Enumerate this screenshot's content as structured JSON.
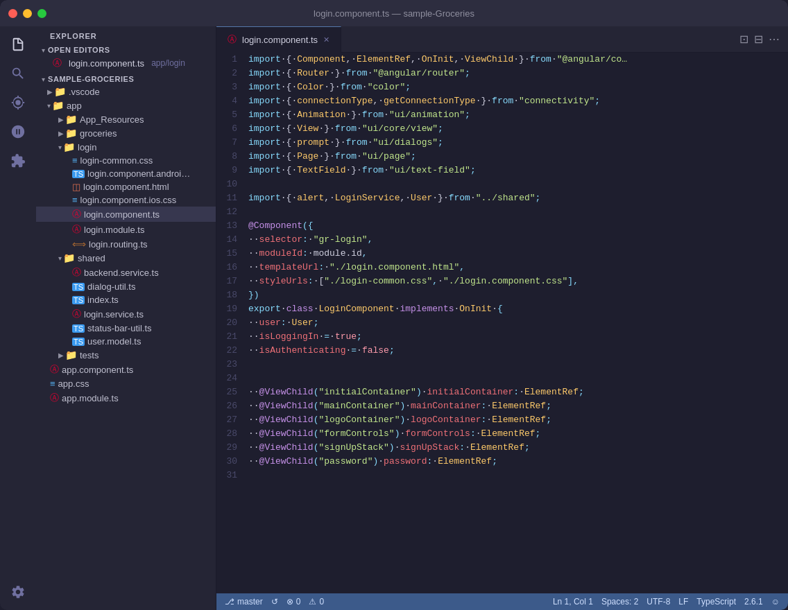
{
  "titlebar": {
    "title": "login.component.ts — sample-Groceries"
  },
  "activitybar": {
    "icons": [
      {
        "name": "files-icon",
        "symbol": "⎘",
        "active": true
      },
      {
        "name": "search-icon",
        "symbol": "🔍",
        "active": false
      },
      {
        "name": "git-icon",
        "symbol": "⑂",
        "active": false
      },
      {
        "name": "debug-icon",
        "symbol": "⊘",
        "active": false
      },
      {
        "name": "extensions-icon",
        "symbol": "⊞",
        "active": false
      }
    ],
    "bottom_icons": [
      {
        "name": "settings-icon",
        "symbol": "⚙"
      }
    ]
  },
  "sidebar": {
    "explorer_label": "EXPLORER",
    "open_editors_label": "OPEN EDITORS",
    "open_editors": [
      {
        "file": "login.component.ts",
        "path": "app/login",
        "icon": "angular"
      }
    ],
    "project_label": "SAMPLE-GROCERIES",
    "tree": [
      {
        "level": 1,
        "type": "folder",
        "label": ".vscode",
        "expanded": false
      },
      {
        "level": 1,
        "type": "folder",
        "label": "app",
        "expanded": true
      },
      {
        "level": 2,
        "type": "folder",
        "label": "App_Resources",
        "expanded": false
      },
      {
        "level": 2,
        "type": "folder",
        "label": "groceries",
        "expanded": false
      },
      {
        "level": 2,
        "type": "folder",
        "label": "login",
        "expanded": true
      },
      {
        "level": 3,
        "type": "css",
        "label": "login-common.css"
      },
      {
        "level": 3,
        "type": "ts-plain",
        "label": "login.component.androi..."
      },
      {
        "level": 3,
        "type": "html",
        "label": "login.component.html"
      },
      {
        "level": 3,
        "type": "css",
        "label": "login.component.ios.css"
      },
      {
        "level": 3,
        "type": "angular",
        "label": "login.component.ts",
        "active": true
      },
      {
        "level": 3,
        "type": "angular",
        "label": "login.module.ts"
      },
      {
        "level": 3,
        "type": "routing",
        "label": "login.routing.ts"
      },
      {
        "level": 2,
        "type": "folder",
        "label": "shared",
        "expanded": true
      },
      {
        "level": 3,
        "type": "angular",
        "label": "backend.service.ts"
      },
      {
        "level": 3,
        "type": "ts",
        "label": "dialog-util.ts"
      },
      {
        "level": 3,
        "type": "ts",
        "label": "index.ts"
      },
      {
        "level": 3,
        "type": "angular",
        "label": "login.service.ts"
      },
      {
        "level": 3,
        "type": "ts",
        "label": "status-bar-util.ts"
      },
      {
        "level": 3,
        "type": "ts",
        "label": "user.model.ts"
      },
      {
        "level": 2,
        "type": "folder",
        "label": "tests",
        "expanded": false
      },
      {
        "level": 1,
        "type": "angular",
        "label": "app.component.ts"
      },
      {
        "level": 1,
        "type": "css",
        "label": "app.css"
      },
      {
        "level": 1,
        "type": "angular",
        "label": "app.module.ts"
      }
    ]
  },
  "editor": {
    "tab_label": "login.component.ts",
    "lines": [
      {
        "n": 1,
        "code": "import·{·Component,·ElementRef,·OnInit,·ViewChild·}·from·\"@angular/co…"
      },
      {
        "n": 2,
        "code": "import·{·Router·}·from·\"@angular/router\";"
      },
      {
        "n": 3,
        "code": "import·{·Color·}·from·\"color\";"
      },
      {
        "n": 4,
        "code": "import·{·connectionType,·getConnectionType·}·from·\"connectivity\";"
      },
      {
        "n": 5,
        "code": "import·{·Animation·}·from·\"ui/animation\";"
      },
      {
        "n": 6,
        "code": "import·{·View·}·from·\"ui/core/view\";"
      },
      {
        "n": 7,
        "code": "import·{·prompt·}·from·\"ui/dialogs\";"
      },
      {
        "n": 8,
        "code": "import·{·Page·}·from·\"ui/page\";"
      },
      {
        "n": 9,
        "code": "import·{·TextField·}·from·\"ui/text-field\";"
      },
      {
        "n": 10,
        "code": ""
      },
      {
        "n": 11,
        "code": "import·{·alert,·LoginService,·User·}·from·\"../shared\";"
      },
      {
        "n": 12,
        "code": ""
      },
      {
        "n": 13,
        "code": "@Component({"
      },
      {
        "n": 14,
        "code": "··selector:·\"gr-login\","
      },
      {
        "n": 15,
        "code": "··moduleId:·module.id,"
      },
      {
        "n": 16,
        "code": "··templateUrl:·\"./login.component.html\","
      },
      {
        "n": 17,
        "code": "··styleUrls:·[\"./login-common.css\",·\"./login.component.css\"],"
      },
      {
        "n": 18,
        "code": "})"
      },
      {
        "n": 19,
        "code": "export·class·LoginComponent·implements·OnInit·{"
      },
      {
        "n": 20,
        "code": "··user:·User;"
      },
      {
        "n": 21,
        "code": "··isLoggingIn·=·true;"
      },
      {
        "n": 22,
        "code": "··isAuthenticating·=·false;"
      },
      {
        "n": 23,
        "code": ""
      },
      {
        "n": 24,
        "code": ""
      },
      {
        "n": 25,
        "code": "··@ViewChild(\"initialContainer\")·initialContainer:·ElementRef;"
      },
      {
        "n": 26,
        "code": "··@ViewChild(\"mainContainer\")·mainContainer:·ElementRef;"
      },
      {
        "n": 27,
        "code": "··@ViewChild(\"logoContainer\")·logoContainer:·ElementRef;"
      },
      {
        "n": 28,
        "code": "··@ViewChild(\"formControls\")·formControls:·ElementRef;"
      },
      {
        "n": 29,
        "code": "··@ViewChild(\"signUpStack\")·signUpStack:·ElementRef;"
      },
      {
        "n": 30,
        "code": "··@ViewChild(\"password\")·password:·ElementRef;"
      },
      {
        "n": 31,
        "code": ""
      }
    ]
  },
  "statusbar": {
    "branch": "master",
    "sync": "↺",
    "errors": "⊗ 0",
    "warnings": "⚠ 0",
    "right": {
      "position": "Ln 1, Col 1",
      "spaces": "Spaces: 2",
      "encoding": "UTF-8",
      "lineending": "LF",
      "language": "TypeScript",
      "version": "2.6.1",
      "smiley": "☺"
    }
  }
}
